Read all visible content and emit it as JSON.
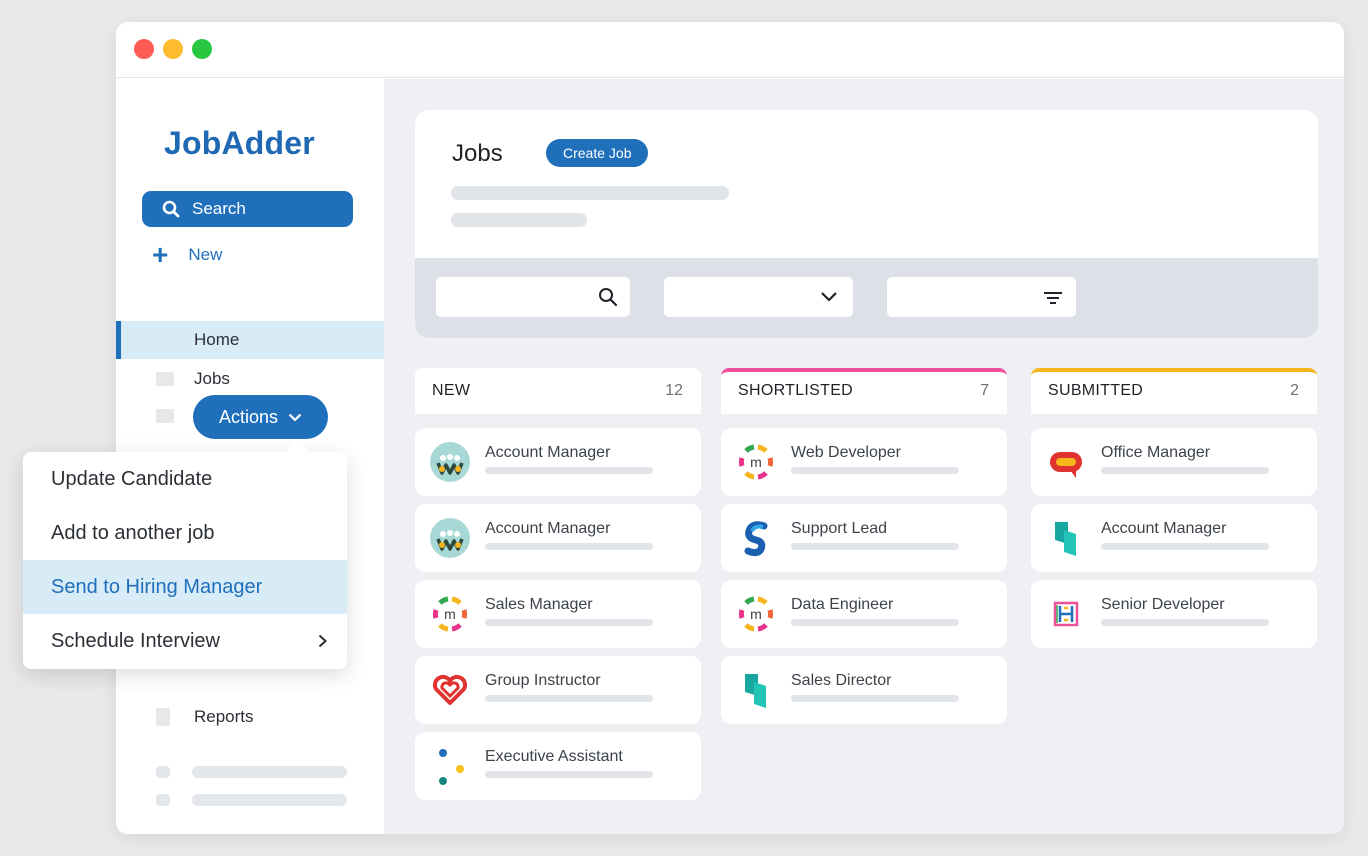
{
  "app": {
    "logo": "JobAdder"
  },
  "sidebar": {
    "search_label": "Search",
    "new_label": "New",
    "nav": {
      "home": "Home",
      "jobs": "Jobs",
      "reports": "Reports"
    }
  },
  "header": {
    "title": "Jobs",
    "create_label": "Create Job"
  },
  "actions": {
    "label": "Actions",
    "menu": [
      {
        "label": "Update Candidate"
      },
      {
        "label": "Add to another job"
      },
      {
        "label": "Send to Hiring Manager",
        "active": true
      },
      {
        "label": "Schedule Interview",
        "has_submenu": true
      }
    ]
  },
  "board": {
    "columns": [
      {
        "name": "NEW",
        "count": "12",
        "accent": "#ffffff",
        "cards": [
          {
            "title": "Account Manager",
            "logo": "w-people-icon"
          },
          {
            "title": "Account Manager",
            "logo": "w-people-icon"
          },
          {
            "title": "Sales Manager",
            "logo": "m-ring-icon"
          },
          {
            "title": "Group Instructor",
            "logo": "heart-icon"
          },
          {
            "title": "Executive Assistant",
            "logo": "dots-icon"
          }
        ]
      },
      {
        "name": "SHORTLISTED",
        "count": "7",
        "accent": "#ef4f9b",
        "cards": [
          {
            "title": "Web Developer",
            "logo": "m-ring-icon"
          },
          {
            "title": "Support Lead",
            "logo": "s-icon"
          },
          {
            "title": "Data Engineer",
            "logo": "m-ring-icon"
          },
          {
            "title": "Sales Director",
            "logo": "blocks-icon"
          }
        ]
      },
      {
        "name": "SUBMITTED",
        "count": "2",
        "accent": "#f6b51c",
        "cards": [
          {
            "title": "Office Manager",
            "logo": "chat-bubble-icon"
          },
          {
            "title": "Account Manager",
            "logo": "blocks-icon"
          },
          {
            "title": "Senior Developer",
            "logo": "h-maze-icon"
          }
        ]
      }
    ]
  },
  "colors": {
    "brand": "#1f6fbb",
    "shortlisted": "#ef4f9b",
    "submitted": "#f6b51c",
    "highlight": "#d8ecf8"
  }
}
